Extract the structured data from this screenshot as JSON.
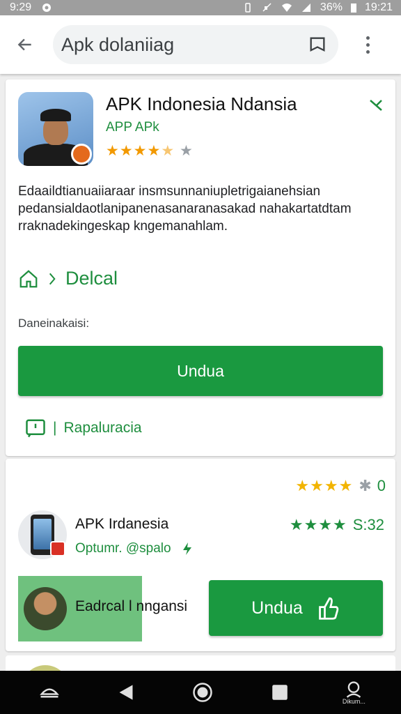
{
  "status_bar": {
    "time_left": "9:29",
    "battery": "36%",
    "time_right": "19:21"
  },
  "toolbar": {
    "search_text": "Apk dolaniiag"
  },
  "app": {
    "title": "APK Indonesia Ndansia",
    "subtitle": "APP APk",
    "rating_stars": 4.5,
    "description": "Edaaildtianuaiiaraar insmsunnaniupletrigaianehsian pedansialdaotlanipanenasanaranasakad nahakartatdtam rraknadekingeskap kngemanahlam.",
    "detail_label": "Delcal",
    "label": "Daneinakaisi:",
    "install_button": "Undua",
    "report_label": "Rapaluracia"
  },
  "list_item": {
    "top_rating_value": "0",
    "title": "APK Irdanesia",
    "subtitle": "Optumr. @spalo",
    "rating_value": "S:32",
    "promo_text": "Eadrcal l nngansi",
    "button": "Undua"
  },
  "nav": {
    "extra_label": "Dikum..."
  },
  "colors": {
    "accent_green": "#1a9940",
    "text_green": "#1e8e3e",
    "star_orange": "#f29900"
  }
}
